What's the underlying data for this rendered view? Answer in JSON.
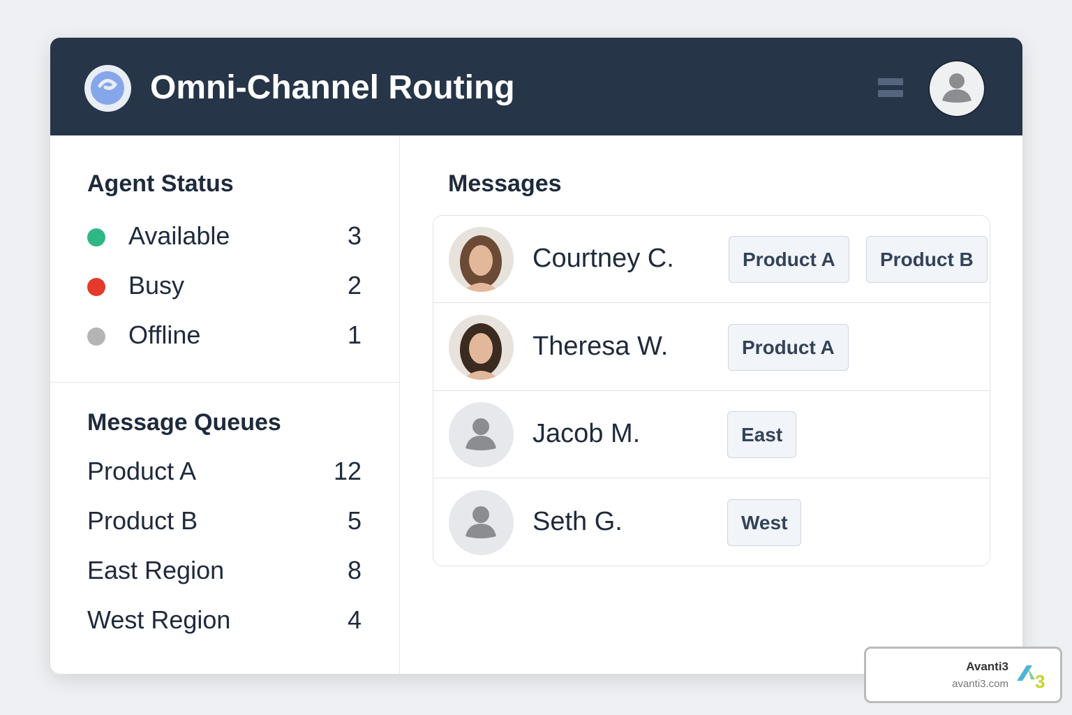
{
  "header": {
    "title": "Omni-Channel Routing"
  },
  "agent_status": {
    "title": "Agent Status",
    "items": [
      {
        "label": "Available",
        "count": "3",
        "color": "#2fb886"
      },
      {
        "label": "Busy",
        "count": "2",
        "color": "#e43a2b"
      },
      {
        "label": "Offline",
        "count": "1",
        "color": "#b4b4b4"
      }
    ]
  },
  "queues": {
    "title": "Message Queues",
    "items": [
      {
        "label": "Product A",
        "count": "12"
      },
      {
        "label": "Product B",
        "count": "5"
      },
      {
        "label": "East Region",
        "count": "8"
      },
      {
        "label": "West Region",
        "count": "4"
      }
    ]
  },
  "messages": {
    "title": "Messages",
    "items": [
      {
        "name": "Courtney C.",
        "tags": [
          "Product A",
          "Product B"
        ]
      },
      {
        "name": "Theresa W.",
        "tags": [
          "Product A"
        ]
      },
      {
        "name": "Jacob M.",
        "tags": [
          "East"
        ]
      },
      {
        "name": "Seth G.",
        "tags": [
          "West"
        ]
      }
    ]
  },
  "watermark": {
    "name": "Avanti3",
    "url": "avanti3.com"
  }
}
